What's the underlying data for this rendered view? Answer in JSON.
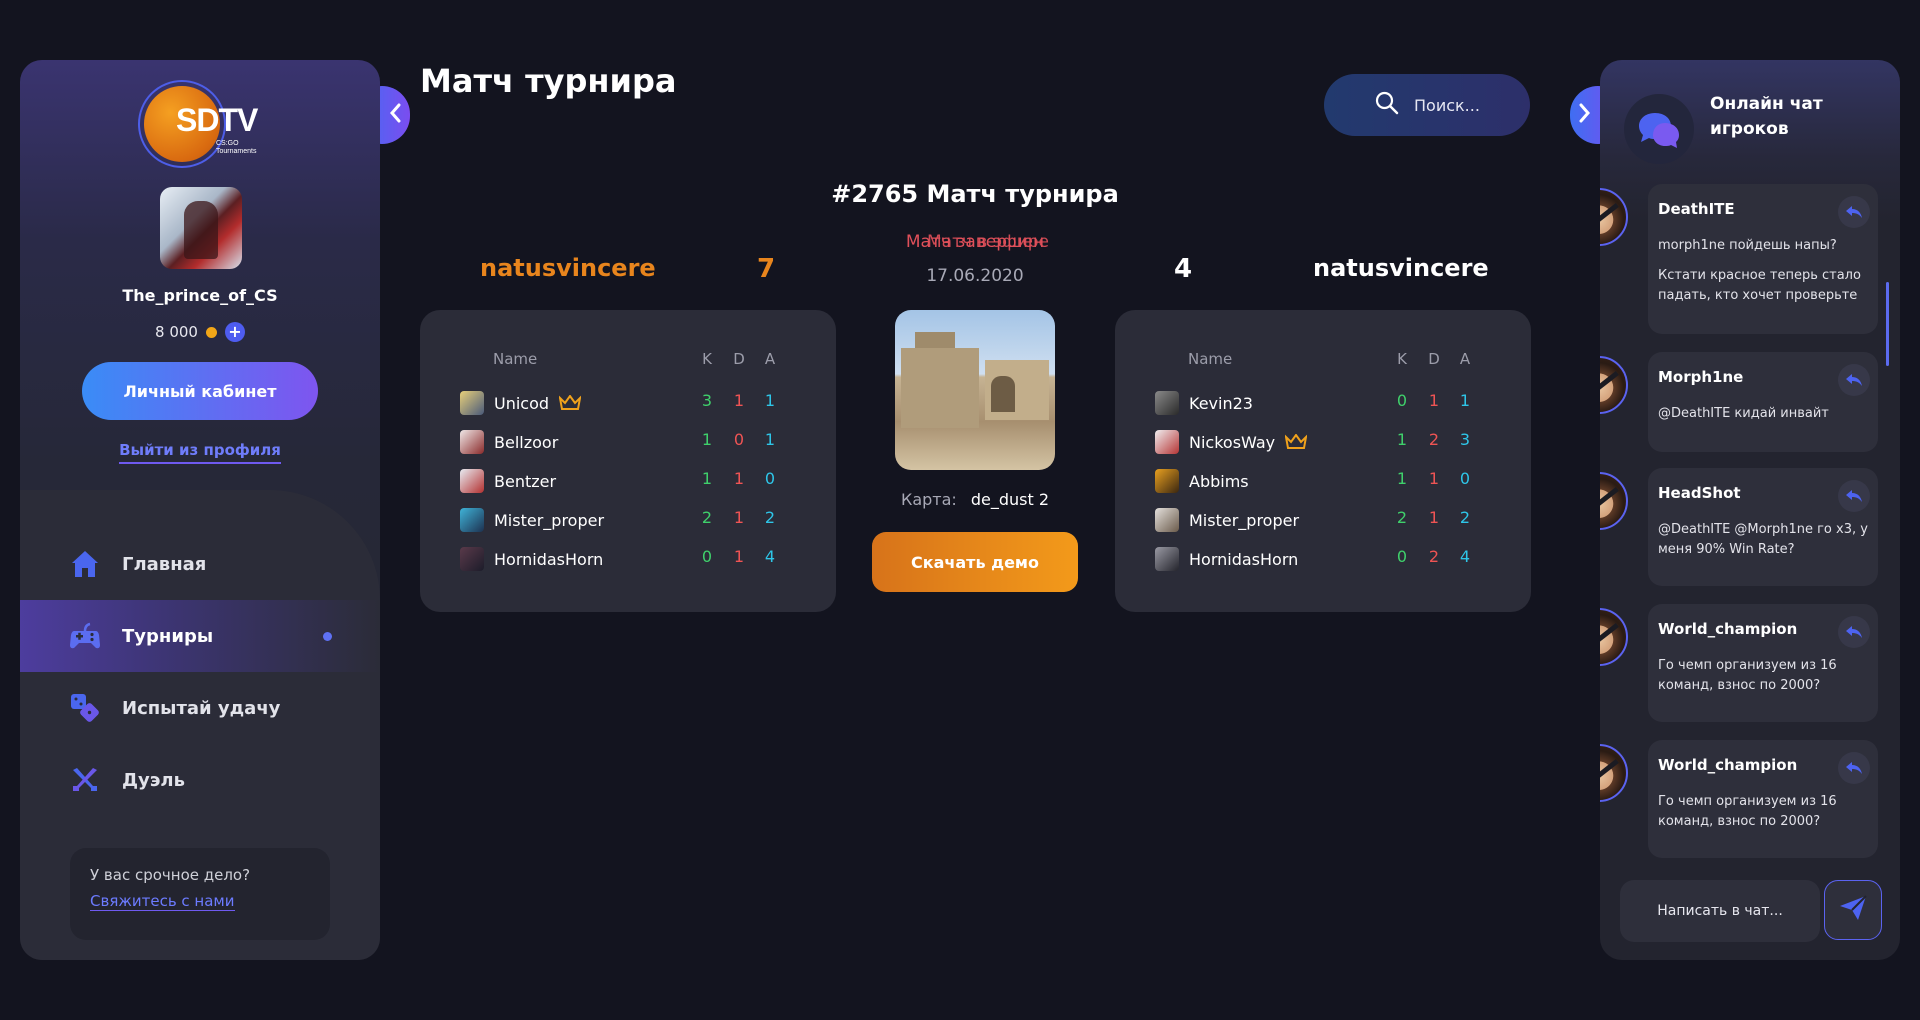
{
  "sidebar": {
    "logo_text": "SDTV",
    "logo_sub": [
      "CS:GO",
      "Tournaments"
    ],
    "username": "The_prince_of_CS",
    "balance": "8 000",
    "cabinet_label": "Личный кабинет",
    "logout_label": "Выйти из профиля",
    "nav": [
      {
        "label": "Главная",
        "icon": "home-icon",
        "active": false
      },
      {
        "label": "Турниры",
        "icon": "gamepad-icon",
        "active": true
      },
      {
        "label": "Испытай удачу",
        "icon": "dice-icon",
        "active": false
      },
      {
        "label": "Дуэль",
        "icon": "crossed-guns-icon",
        "active": false
      }
    ],
    "help_question": "У вас срочное дело?",
    "help_link": "Свяжитесь с нами"
  },
  "header": {
    "title": "Матч турнира",
    "search_placeholder": "Поиск..."
  },
  "match": {
    "title": "#2765 Матч турнира",
    "status": "Матч завершен",
    "status_overlap": "Матч в эфире",
    "date": "17.06.2020",
    "map_label": "Карта:",
    "map_name": "de_dust 2",
    "demo_label": "Скачать демо",
    "team_left": {
      "name": "natusvincere",
      "score": "7"
    },
    "team_right": {
      "name": "natusvincere",
      "score": "4"
    },
    "columns": {
      "name": "Name",
      "k": "K",
      "d": "D",
      "a": "A"
    },
    "players_left": [
      {
        "name": "Unicod",
        "k": "3",
        "d": "1",
        "a": "1",
        "captain": true
      },
      {
        "name": "Bellzoor",
        "k": "1",
        "d": "0",
        "a": "1",
        "captain": false
      },
      {
        "name": "Bentzer",
        "k": "1",
        "d": "1",
        "a": "0",
        "captain": false
      },
      {
        "name": "Mister_proper",
        "k": "2",
        "d": "1",
        "a": "2",
        "captain": false
      },
      {
        "name": "HornidasHorn",
        "k": "0",
        "d": "1",
        "a": "4",
        "captain": false
      }
    ],
    "players_right": [
      {
        "name": "Kevin23",
        "k": "0",
        "d": "1",
        "a": "1",
        "captain": false
      },
      {
        "name": "NickosWay",
        "k": "1",
        "d": "2",
        "a": "3",
        "captain": true
      },
      {
        "name": "Abbims",
        "k": "1",
        "d": "1",
        "a": "0",
        "captain": false
      },
      {
        "name": "Mister_proper",
        "k": "2",
        "d": "1",
        "a": "2",
        "captain": false
      },
      {
        "name": "HornidasHorn",
        "k": "0",
        "d": "2",
        "a": "4",
        "captain": false
      }
    ]
  },
  "chat": {
    "title": "Онлайн чат игроков",
    "input_placeholder": "Написать в чат...",
    "messages": [
      {
        "author": "DeathITE",
        "lines": [
          "morph1ne пойдешь напы?",
          "Кстати красное теперь стало падать, кто хочет проверьте"
        ]
      },
      {
        "author": "Morph1ne",
        "lines": [
          "@DeathITE кидай инвайт"
        ]
      },
      {
        "author": "HeadShot",
        "lines": [
          "@DeathITE @Morph1ne го х3, у меня 90% Win Rate?"
        ]
      },
      {
        "author": "World_champion",
        "lines": [
          "Го чемп организуем из 16 команд, взнос по 2000?"
        ]
      },
      {
        "author": "World_champion",
        "lines": [
          "Го чемп организуем из 16 команд, взнос по 2000?"
        ]
      }
    ]
  },
  "colors": {
    "accent_blue": "#4e5cf0",
    "accent_orange": "#e8851d",
    "kills": "#3fd06b",
    "deaths": "#ef5454",
    "assists": "#2ec6e8",
    "background": "#13141f"
  }
}
